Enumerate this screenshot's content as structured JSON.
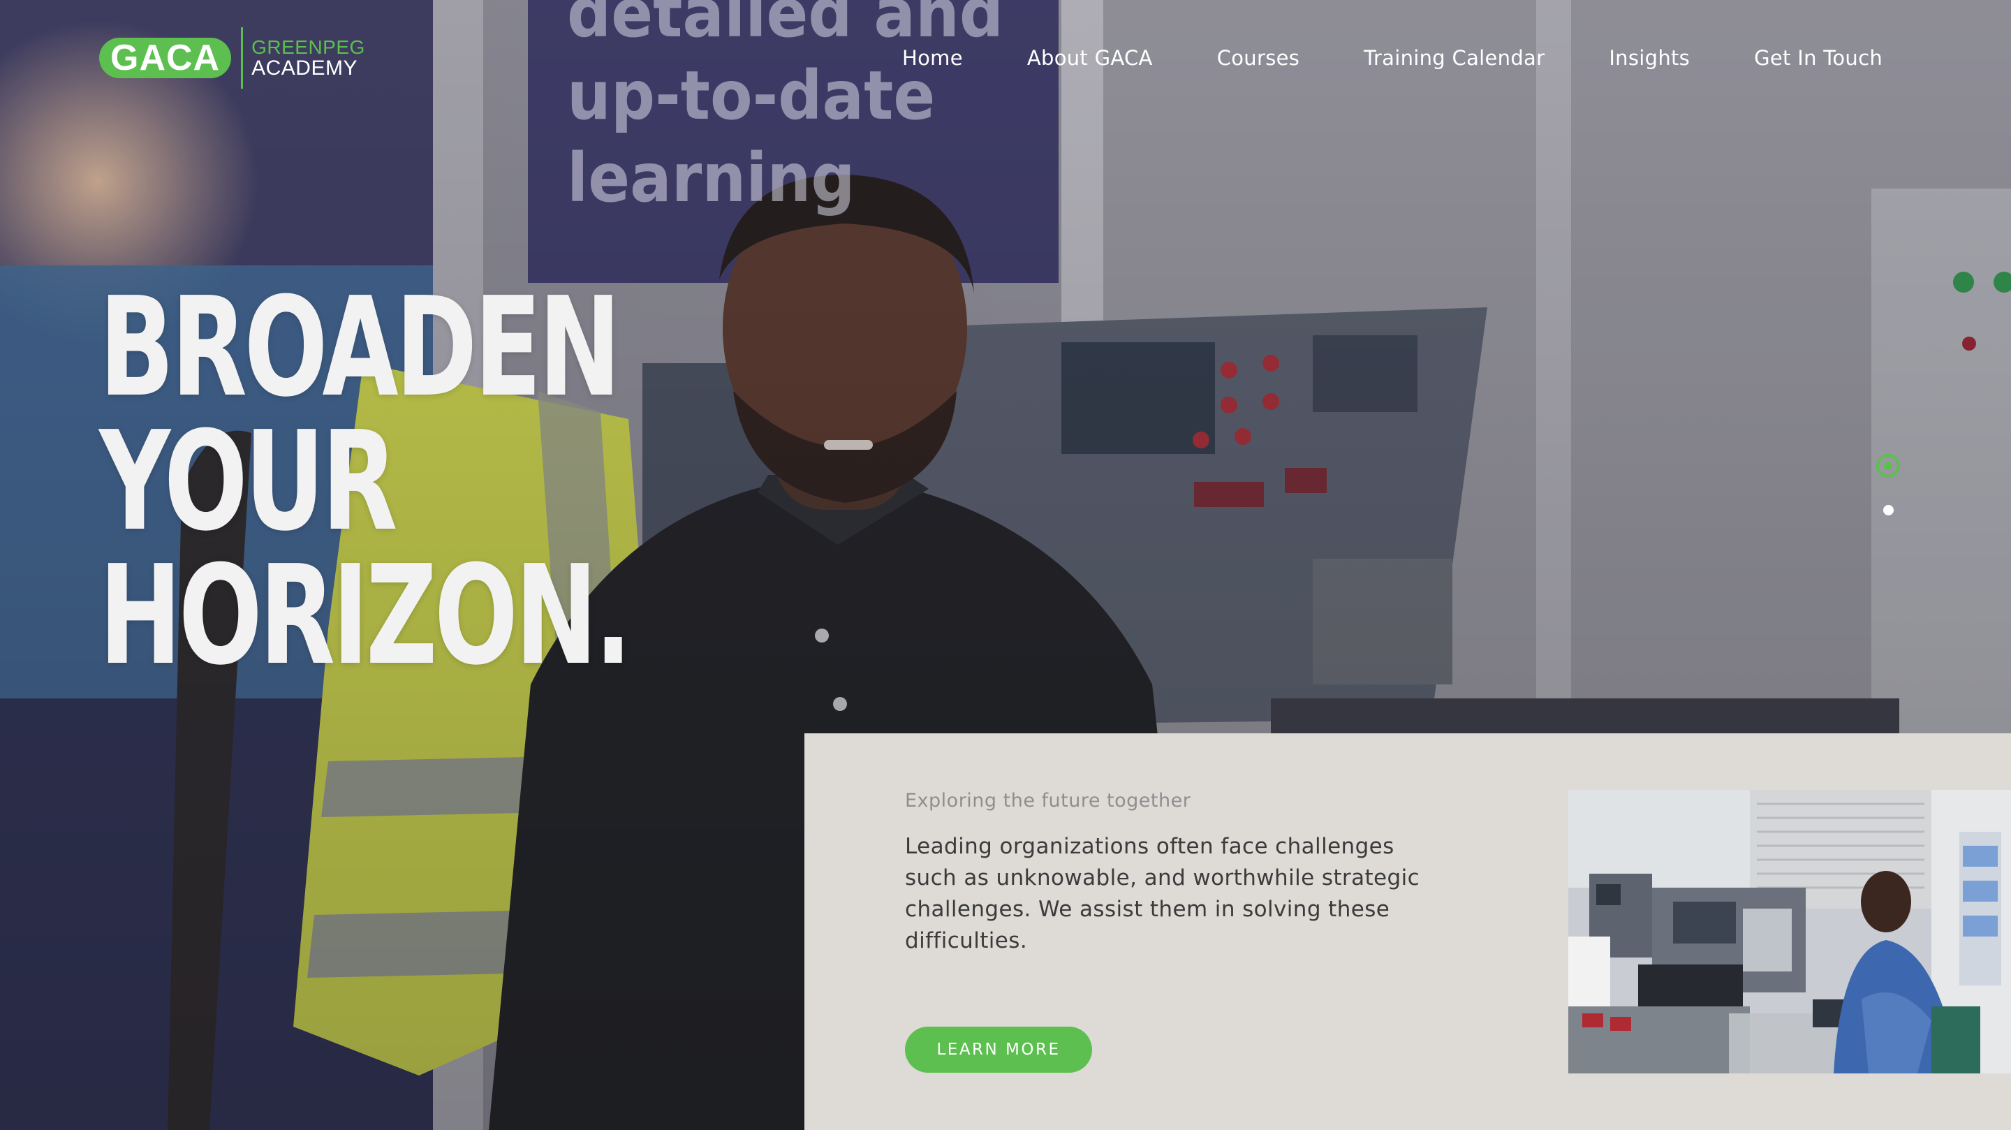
{
  "brand": {
    "badge": "GACA",
    "line1": "GREENPEG",
    "line2": "ACADEMY",
    "accent_color": "#5cbf4f"
  },
  "nav": {
    "items": [
      {
        "label": "Home"
      },
      {
        "label": "About GACA"
      },
      {
        "label": "Courses"
      },
      {
        "label": "Training Calendar"
      },
      {
        "label": "Insights"
      },
      {
        "label": "Get In Touch"
      }
    ]
  },
  "hero": {
    "headline": [
      "BROADEN",
      "YOUR",
      "HORIZON."
    ],
    "background_signage": [
      "detailed and",
      "up-to-date",
      "learning"
    ],
    "slides_total": 2,
    "active_slide": 1
  },
  "panel": {
    "eyebrow": "Exploring the future together",
    "body": "Leading organizations often face challenges such as unknowable, and worthwhile strategic challenges. We assist them in solving these difficulties.",
    "cta": "LEARN MORE",
    "panel_color": "#dedbd7"
  }
}
